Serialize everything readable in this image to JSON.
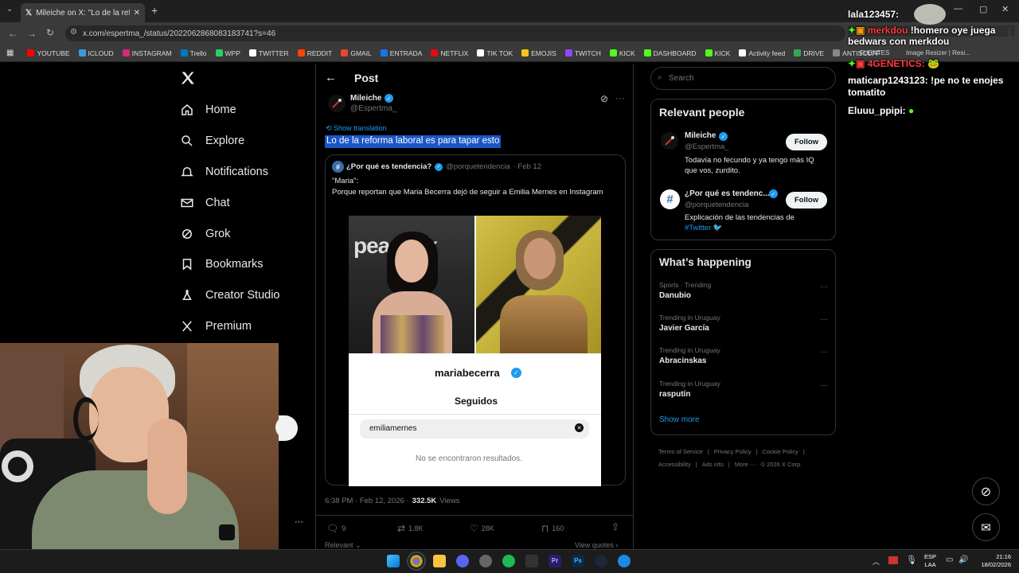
{
  "browser": {
    "tab_title": "Mileiche on X: \"Lo de la reforma",
    "url": "x.com/espertma_/status/2022062868083183741?s=46",
    "bookmarks": [
      {
        "label": "YOUTUBE",
        "color": "#ff0000"
      },
      {
        "label": "ICLOUD",
        "color": "#3a9bdc"
      },
      {
        "label": "INSTAGRAM",
        "color": "#d62976"
      },
      {
        "label": "Trello",
        "color": "#0079bf"
      },
      {
        "label": "WPP",
        "color": "#25d366"
      },
      {
        "label": "TWITTER",
        "color": "#ffffff"
      },
      {
        "label": "REDDIT",
        "color": "#ff4500"
      },
      {
        "label": "GMAIL",
        "color": "#ea4335"
      },
      {
        "label": "ENTRADA",
        "color": "#1a73e8"
      },
      {
        "label": "NETFLIX",
        "color": "#e50914"
      },
      {
        "label": "TIK TOK",
        "color": "#ffffff"
      },
      {
        "label": "EMOJIS",
        "color": "#f5c518"
      },
      {
        "label": "TWITCH",
        "color": "#9146ff"
      },
      {
        "label": "KICK",
        "color": "#53fc18"
      },
      {
        "label": "DASHBOARD",
        "color": "#53fc18"
      },
      {
        "label": "KICK",
        "color": "#53fc18"
      },
      {
        "label": "Activity feed",
        "color": "#ffffff"
      },
      {
        "label": "DRIVE",
        "color": "#34a853"
      },
      {
        "label": "ANTISCUFF",
        "color": "#888888"
      }
    ]
  },
  "nav": {
    "items": [
      {
        "label": "Home"
      },
      {
        "label": "Explore"
      },
      {
        "label": "Notifications"
      },
      {
        "label": "Chat"
      },
      {
        "label": "Grok"
      },
      {
        "label": "Bookmarks"
      },
      {
        "label": "Creator Studio"
      },
      {
        "label": "Premium"
      }
    ]
  },
  "post": {
    "header": "Post",
    "author_name": "Mileiche",
    "author_handle": "@Espertma_",
    "show_translation": "Show translation",
    "text": "Lo de la reforma laboral es para tapar esto",
    "quote": {
      "name": "¿Por qué es tendencia?",
      "handle": "@porquetendencia",
      "date": "· Feb 12",
      "line1": "\"Maria\":",
      "line2": "Porque reportan que Maria Becerra dejó de seguir a Emilia Mernes en Instagram",
      "image_logo_text": "peacock",
      "sheet_username": "mariabecerra",
      "sheet_tab": "Seguidos",
      "sheet_search": "emiliamernes",
      "sheet_empty": "No se encontraron resultados."
    },
    "timestamp": "6:38 PM · Feb 12, 2026 ·",
    "views_count": "332.5K",
    "views_label": "Views",
    "actions": {
      "replies": "9",
      "reposts": "1.8K",
      "likes": "28K",
      "bookmarks": "160"
    },
    "relevant_label": "Relevant",
    "view_quotes_label": "View quotes"
  },
  "sidebar": {
    "search_placeholder": "Search",
    "relevant_title": "Relevant people",
    "people": [
      {
        "name": "Mileiche",
        "handle": "@Espertma_",
        "bio": "Todavía no fecundo y ya tengo más IQ que vos, zurdito.",
        "follow": "Follow"
      },
      {
        "name": "¿Por qué es tendenc...",
        "handle": "@porquetendencia",
        "bio": "Explicación de las tendencias de",
        "bio_tag": "#Twitter",
        "follow": "Follow"
      }
    ],
    "happening_title": "What’s happening",
    "trends": [
      {
        "meta": "Sports · Trending",
        "name": "Danubio"
      },
      {
        "meta": "Trending in Uruguay",
        "name": "Javier García"
      },
      {
        "meta": "Trending in Uruguay",
        "name": "Abracinskas"
      },
      {
        "meta": "Trending in Uruguay",
        "name": "rasputín"
      }
    ],
    "show_more": "Show more",
    "footer": [
      "Terms of Service",
      "|",
      "Privacy Policy",
      "|",
      "Cookie Policy",
      "|",
      "Accessibility",
      "|",
      "Ads info",
      "|",
      "More ···",
      "© 2026 X Corp."
    ]
  },
  "chat": {
    "messages": [
      {
        "user": "lala123457:",
        "text": ""
      },
      {
        "user": "merkdou",
        "text": "!homero oye juega bedwars con merkdou"
      },
      {
        "user": "4GENETICS:",
        "text": ""
      },
      {
        "user": "maticarp1243123:",
        "text": "!pe no te enojes tomatito"
      },
      {
        "user": "Eluuu_ppipi:",
        "text": ""
      }
    ],
    "overlay_fuentes": "FUENTES",
    "overlay_image": "Image Resizer | Resi..."
  },
  "taskbar": {
    "lang_top": "ESP",
    "lang_bottom": "LAA",
    "time": "21:16",
    "date": "18/02/2026"
  }
}
